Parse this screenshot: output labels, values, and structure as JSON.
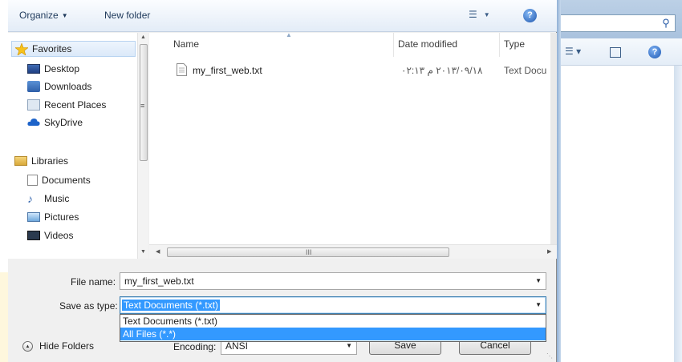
{
  "toolbar": {
    "organize_label": "Organize",
    "new_folder_label": "New folder",
    "help_glyph": "?"
  },
  "nav": {
    "favorites": {
      "label": "Favorites",
      "icon": "star-icon"
    },
    "items": [
      {
        "label": "Desktop",
        "icon": "desktop-icon"
      },
      {
        "label": "Downloads",
        "icon": "downloads-icon"
      },
      {
        "label": "Recent Places",
        "icon": "recent-places-icon"
      },
      {
        "label": "SkyDrive",
        "icon": "cloud-icon"
      }
    ],
    "libraries": {
      "label": "Libraries",
      "icon": "libraries-icon"
    },
    "library_items": [
      {
        "label": "Documents",
        "icon": "document-icon"
      },
      {
        "label": "Music",
        "icon": "music-icon"
      },
      {
        "label": "Pictures",
        "icon": "pictures-icon"
      },
      {
        "label": "Videos",
        "icon": "videos-icon"
      }
    ]
  },
  "files": {
    "columns": [
      "Name",
      "Date modified",
      "Type"
    ],
    "rows": [
      {
        "name": "my_first_web.txt",
        "date": "٢٠١٣/٠٩/١٨ م ٠٢:١٣",
        "type": "Text Docu"
      }
    ],
    "scroll_grip": "III"
  },
  "form": {
    "file_name_label": "File name:",
    "file_name_value": "my_first_web.txt",
    "save_type_label": "Save as type:",
    "save_type_value": "Text Documents (*.txt)",
    "type_options": [
      "Text Documents (*.txt)",
      "All Files  (*.*)"
    ],
    "highlighted_option_index": 1,
    "encoding_label": "Encoding:",
    "encoding_value": "ANSI",
    "save_label": "Save",
    "cancel_label": "Cancel",
    "hide_folders_label": "Hide Folders"
  },
  "colors": {
    "selection": "#3399ff",
    "toolbar_text": "#1e395b"
  }
}
